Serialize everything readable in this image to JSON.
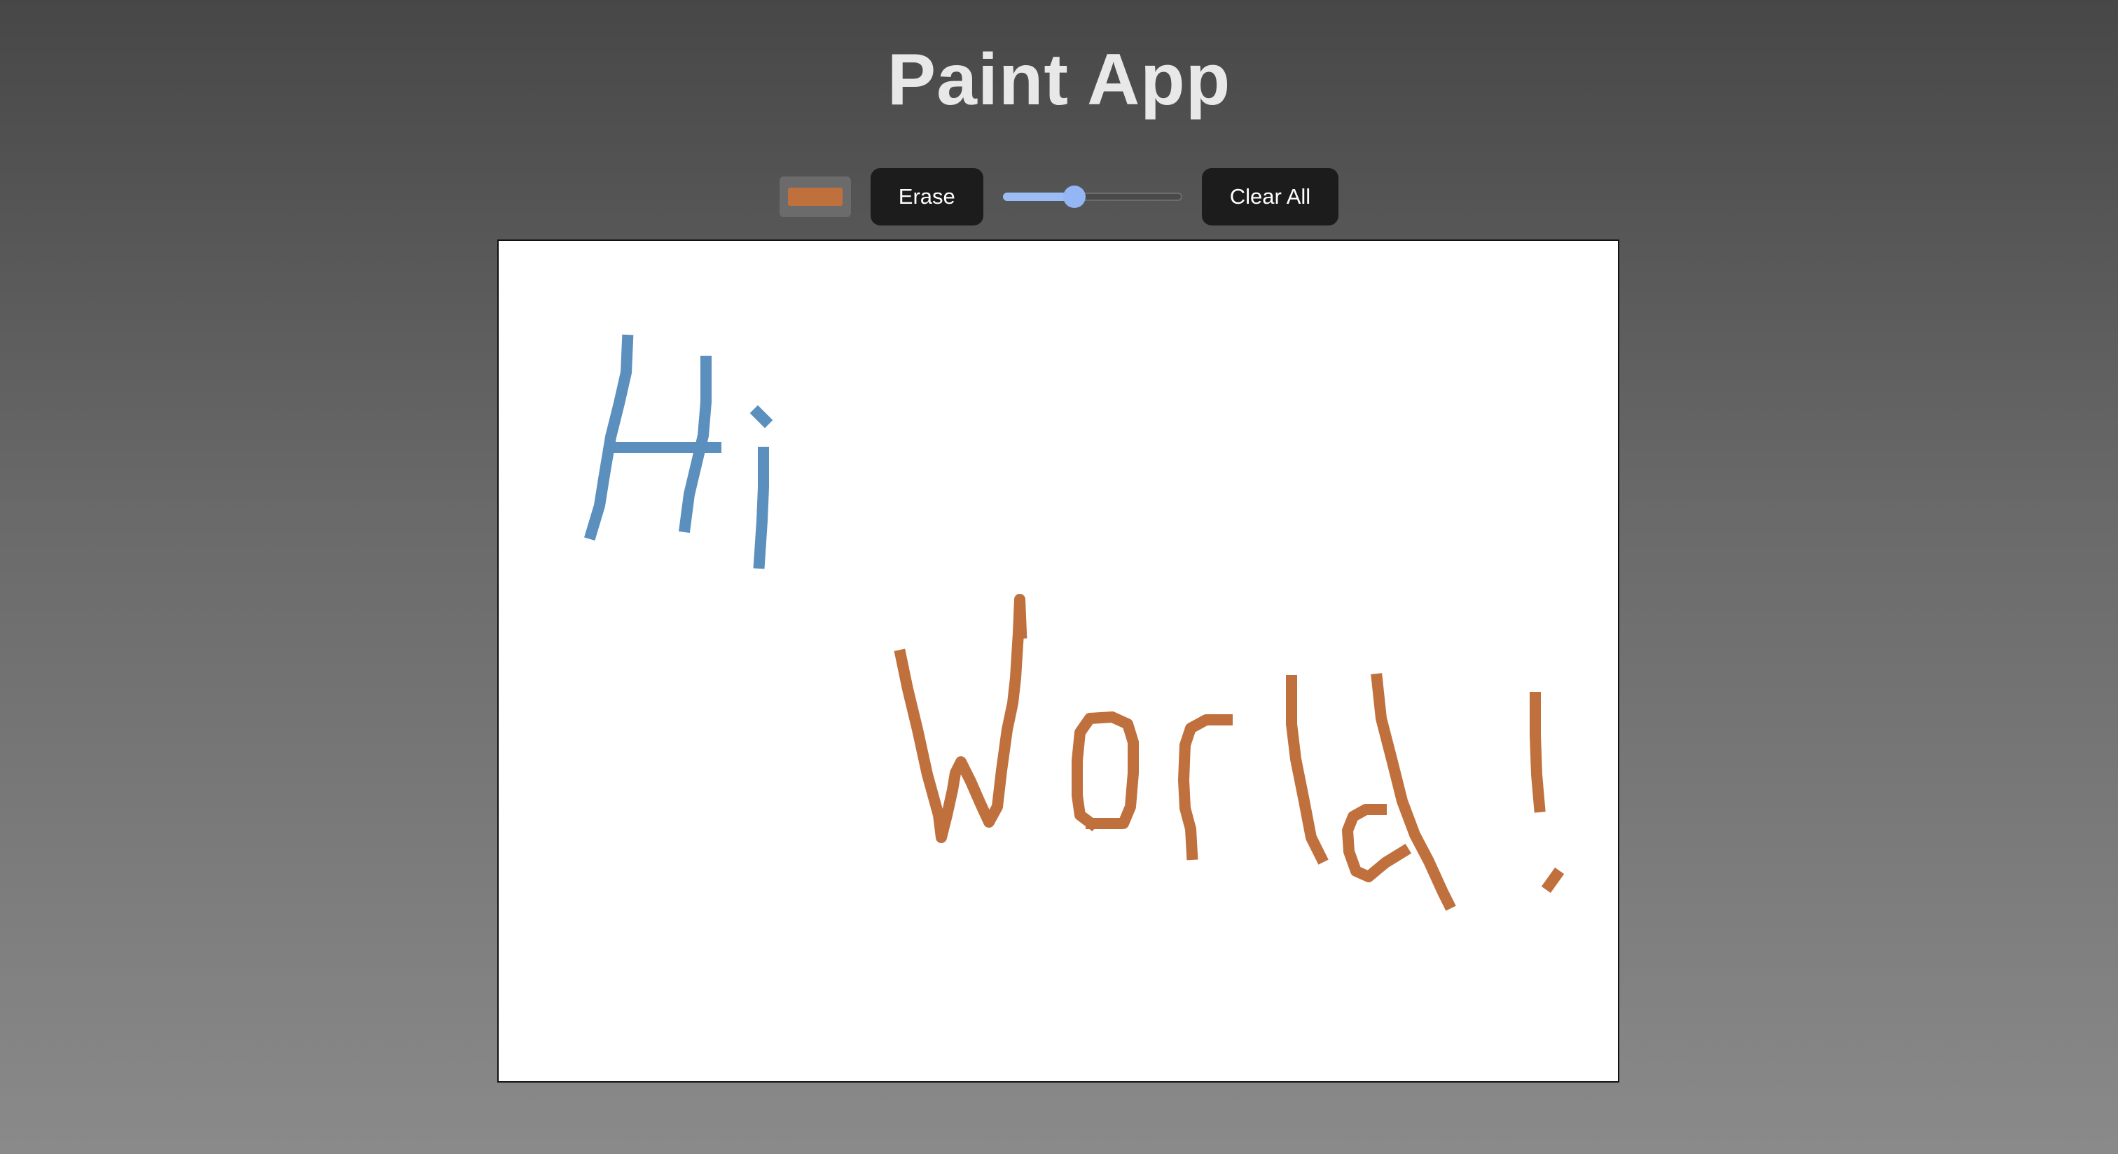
{
  "app": {
    "title": "Paint App"
  },
  "toolbar": {
    "color_picker": {
      "value": "#c0703c"
    },
    "erase_label": "Erase",
    "brush_size": {
      "fraction": 0.4
    },
    "clear_label": "Clear All"
  },
  "canvas": {
    "background": "#ffffff",
    "drawing": {
      "hi": {
        "text": "Hi",
        "color": "#5b8fbe"
      },
      "world": {
        "text": "World!",
        "color": "#c0703c"
      }
    }
  }
}
